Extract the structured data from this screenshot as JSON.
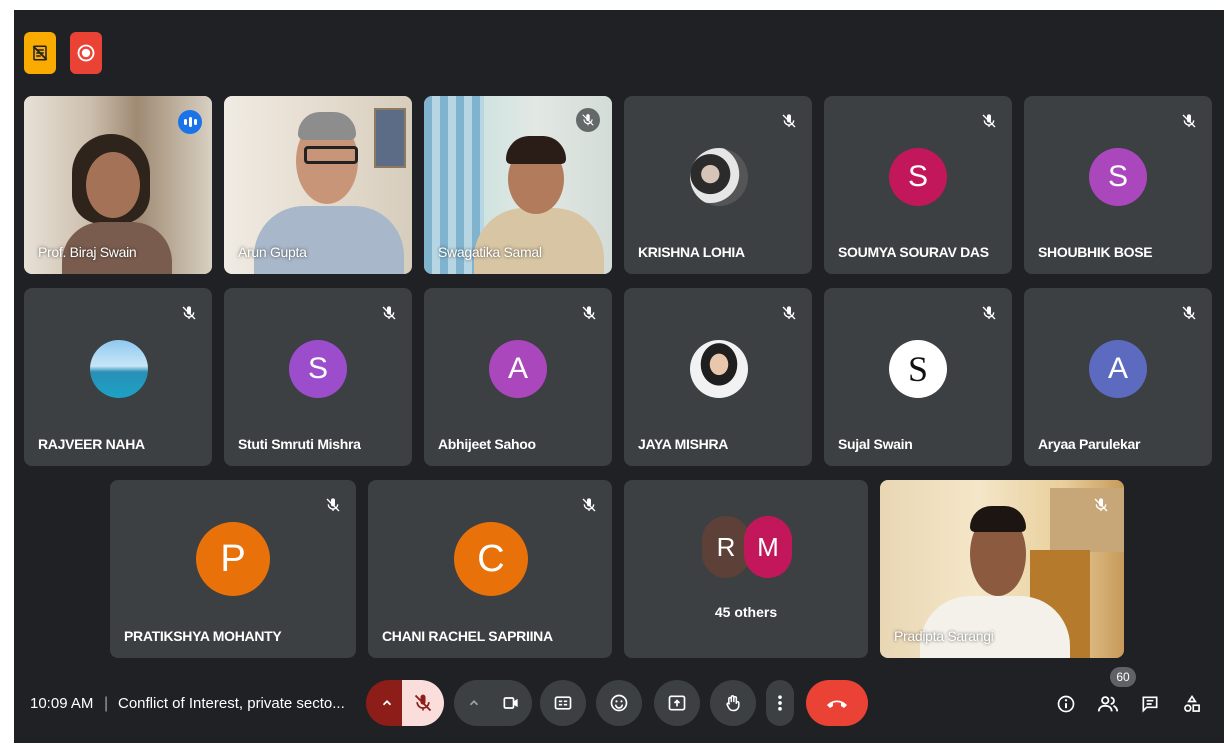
{
  "top_badges": [
    {
      "icon": "notes-off-icon",
      "color": "#f9ab00"
    },
    {
      "icon": "recording-icon",
      "color": "#ea4335"
    }
  ],
  "participants": [
    {
      "name": "Prof. Biraj Swain",
      "type": "video",
      "speaking": true
    },
    {
      "name": "Arun Gupta",
      "type": "video"
    },
    {
      "name": "Swagatika Samal",
      "type": "video",
      "muted": true
    },
    {
      "name": "KRISHNA LOHIA",
      "type": "photo-avatar",
      "muted": true
    },
    {
      "name": "SOUMYA SOURAV DAS",
      "type": "letter",
      "letter": "S",
      "color": "#c2185b",
      "muted": true
    },
    {
      "name": "SHOUBHIK BOSE",
      "type": "letter",
      "letter": "S",
      "color": "#ab47bc",
      "muted": true
    },
    {
      "name": "RAJVEER NAHA",
      "type": "photo-avatar",
      "muted": true
    },
    {
      "name": "Stuti Smruti Mishra",
      "type": "letter",
      "letter": "S",
      "color": "#9c4dcc",
      "muted": true
    },
    {
      "name": "Abhijeet Sahoo",
      "type": "letter",
      "letter": "A",
      "color": "#ab47bc",
      "muted": true
    },
    {
      "name": "JAYA MISHRA",
      "type": "photo-avatar",
      "muted": true
    },
    {
      "name": "Sujal Swain",
      "type": "logo-avatar",
      "letter": "S",
      "muted": true
    },
    {
      "name": "Aryaa Parulekar",
      "type": "letter",
      "letter": "A",
      "color": "#5c6bc0",
      "muted": true
    },
    {
      "name": "PRATIKSHYA MOHANTY",
      "type": "letter",
      "letter": "P",
      "color": "#e8710a",
      "muted": true
    },
    {
      "name": "CHANI RACHEL SAPRIINA",
      "type": "letter",
      "letter": "C",
      "color": "#e8710a",
      "muted": true
    },
    {
      "name": "Pradipta Sarangi",
      "type": "video",
      "muted": true
    }
  ],
  "others": {
    "label": "45 others",
    "avatars": [
      {
        "letter": "R",
        "color": "#5d4037"
      },
      {
        "letter": "M",
        "color": "#c2185b"
      }
    ]
  },
  "bottom_bar": {
    "time": "10:09 AM",
    "separator": "|",
    "meeting_title": "Conflict of Interest, private secto...",
    "participant_count": "60",
    "controls": [
      "mic-options",
      "microphone-muted",
      "camera-options",
      "camera",
      "captions",
      "emoji",
      "present",
      "raise-hand",
      "more-options",
      "leave-call"
    ],
    "right_icons": [
      "info-icon",
      "people-icon",
      "chat-icon",
      "activities-icon"
    ],
    "leave_color": "#ea4335",
    "mic_muted_color": "#f9dedc"
  }
}
